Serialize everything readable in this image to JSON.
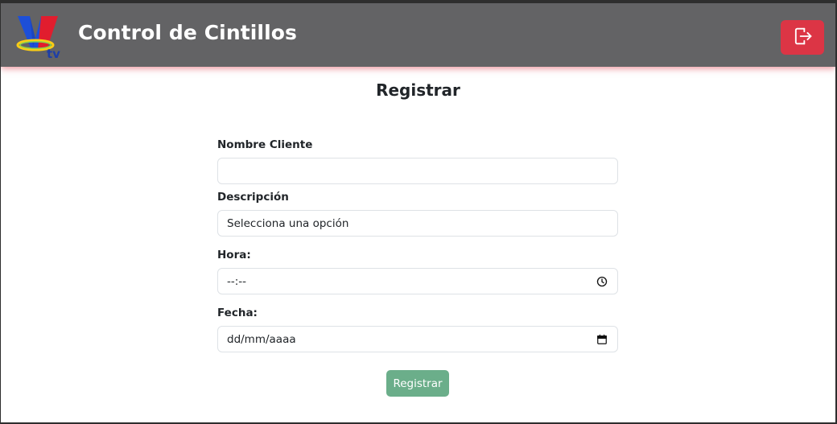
{
  "header": {
    "logo_text": "tv",
    "title": "Control de Cintillos",
    "logout_icon": "logout-icon",
    "accent_color": "#dc3545",
    "bar_color": "#636365"
  },
  "form": {
    "title": "Registrar",
    "fields": {
      "cliente": {
        "label": "Nombre Cliente",
        "value": ""
      },
      "descripcion": {
        "label": "Descripción",
        "selected": "Selecciona una opción"
      },
      "hora": {
        "label": "Hora:",
        "value": "--:--",
        "icon": "clock-icon"
      },
      "fecha": {
        "label": "Fecha:",
        "value": "dd/mm/aaaa",
        "icon": "calendar-icon"
      }
    },
    "submit_label": "Registrar",
    "submit_color": "#6bae8a"
  }
}
